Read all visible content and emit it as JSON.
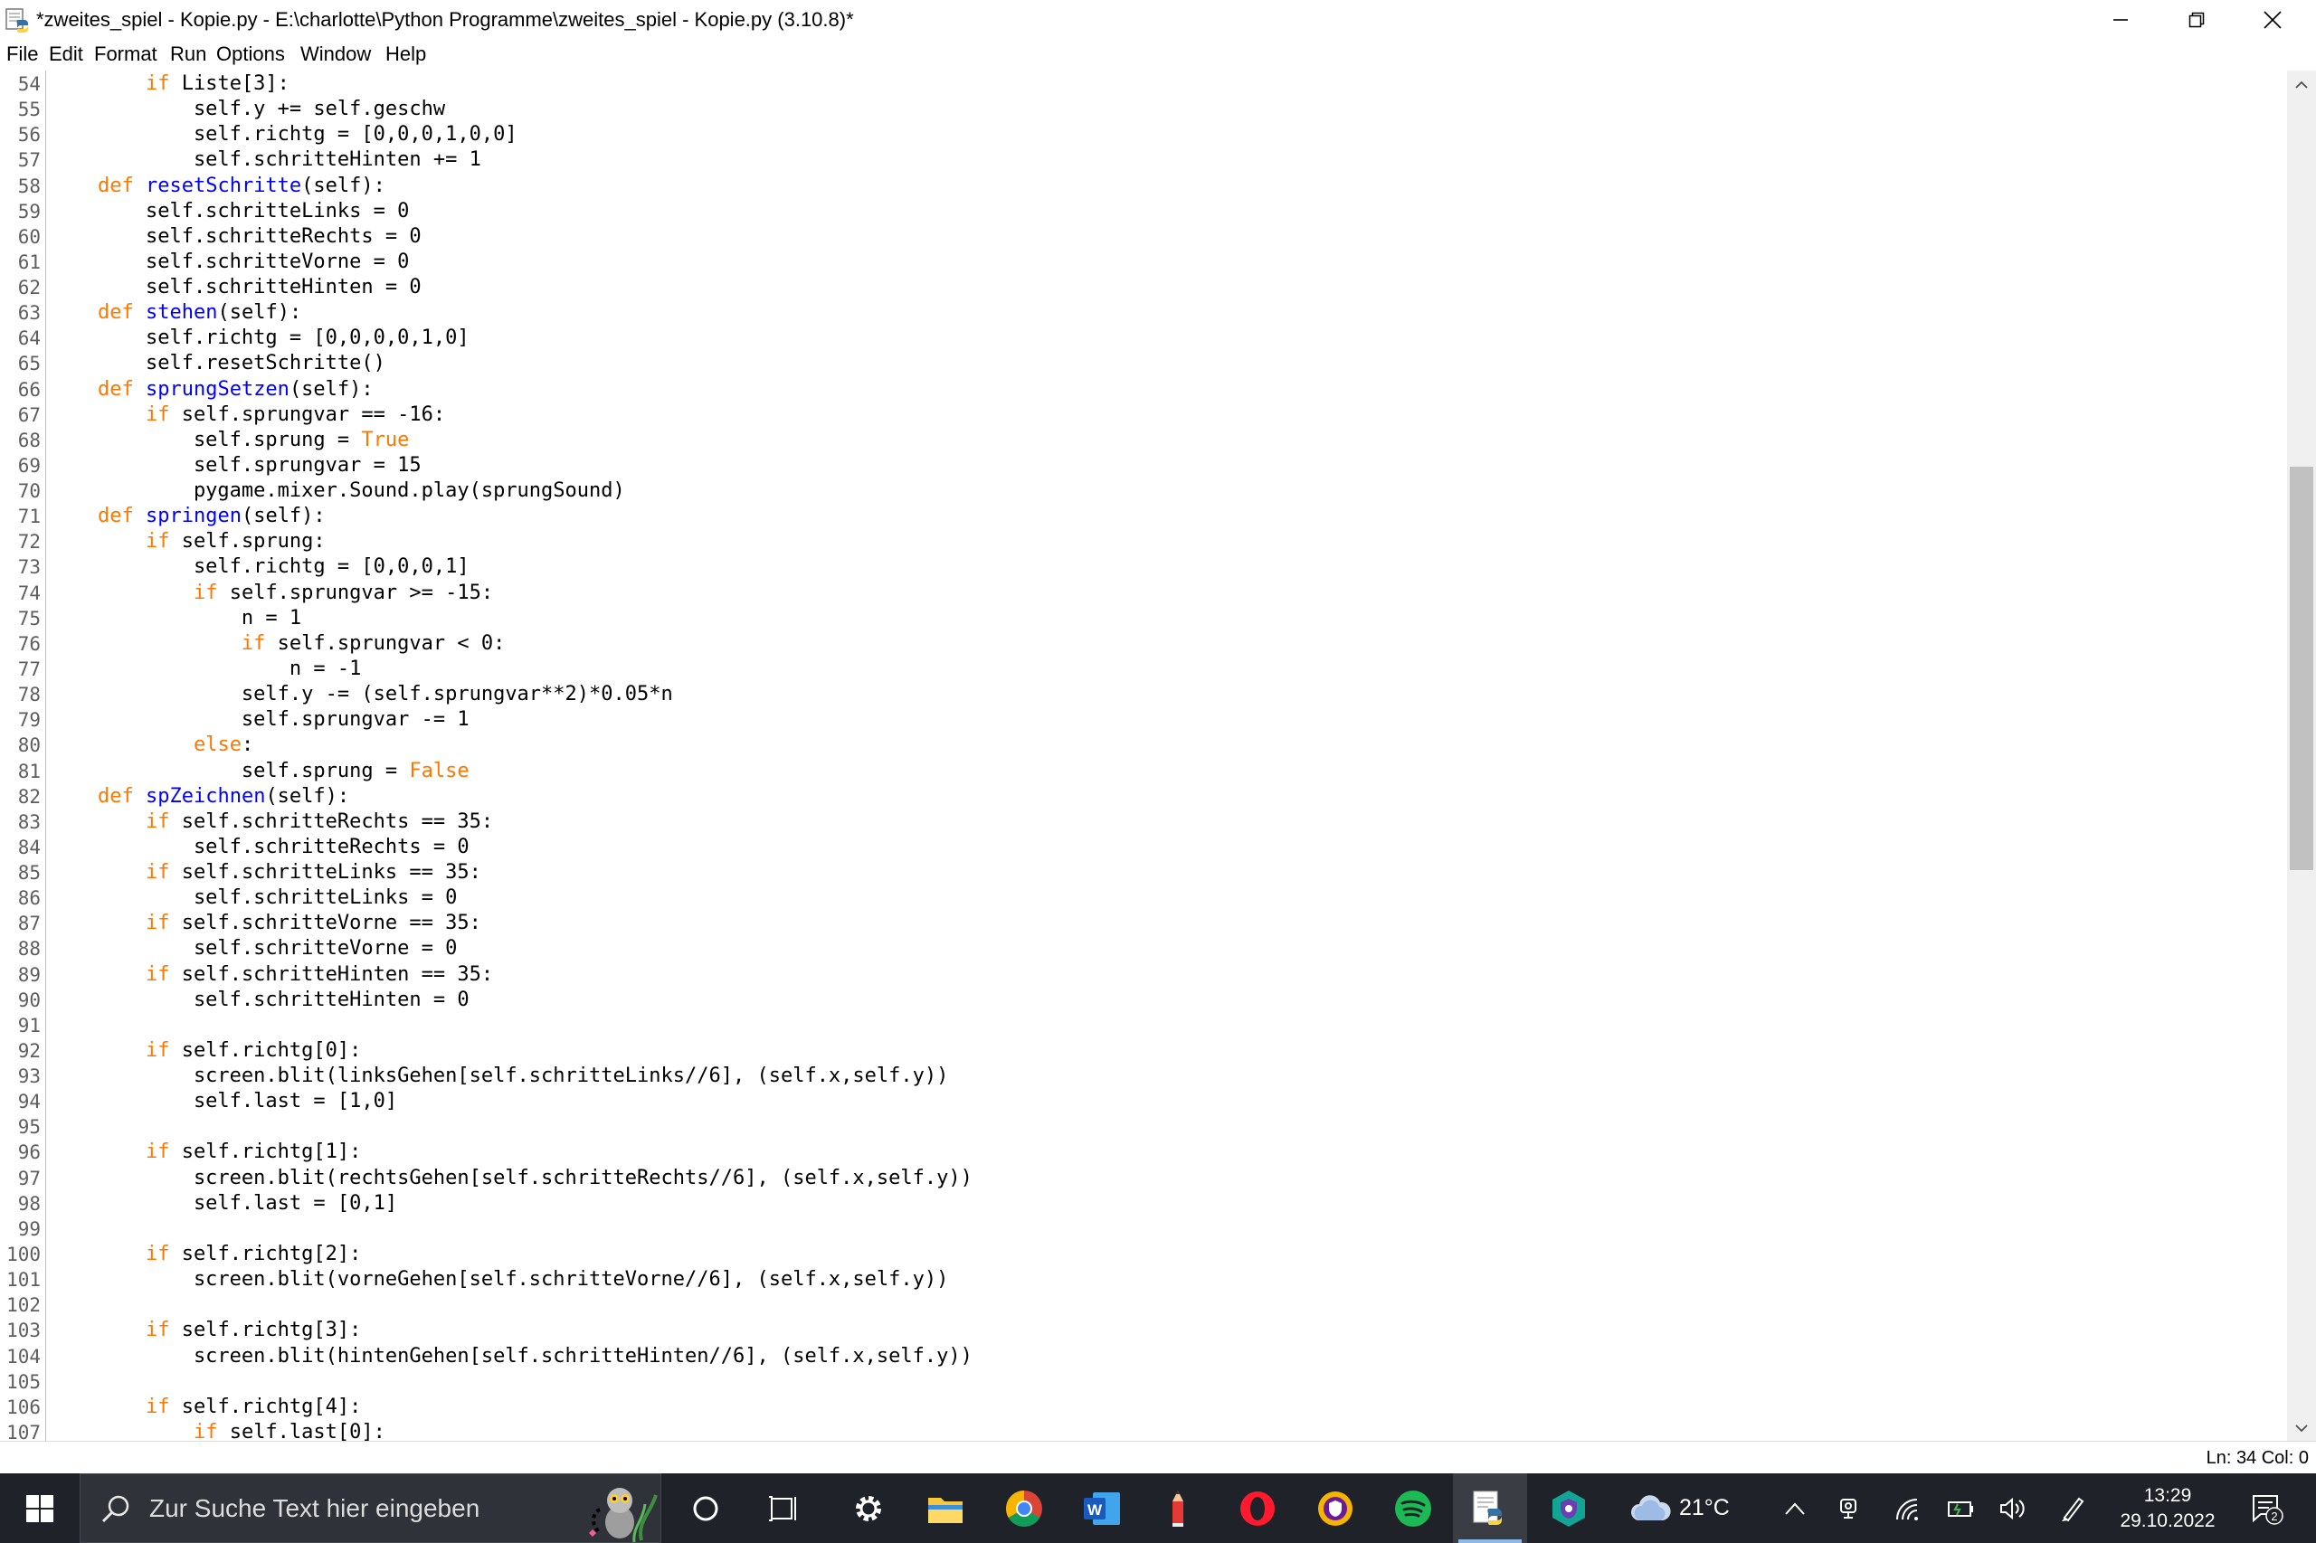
{
  "window": {
    "title": "*zweites_spiel - Kopie.py - E:\\charlotte\\Python Programme\\zweites_spiel - Kopie.py (3.10.8)*"
  },
  "menu": [
    "File",
    "Edit",
    "Format",
    "Run",
    "Options",
    "Window",
    "Help"
  ],
  "code_lines": [
    {
      "n": "54",
      "text": "        if Liste[3]:"
    },
    {
      "n": "55",
      "text": "            self.y += self.geschw"
    },
    {
      "n": "56",
      "text": "            self.richtg = [0,0,0,1,0,0]"
    },
    {
      "n": "57",
      "text": "            self.schritteHinten += 1"
    },
    {
      "n": "58",
      "text": "    def resetSchritte(self):"
    },
    {
      "n": "59",
      "text": "        self.schritteLinks = 0"
    },
    {
      "n": "60",
      "text": "        self.schritteRechts = 0"
    },
    {
      "n": "61",
      "text": "        self.schritteVorne = 0"
    },
    {
      "n": "62",
      "text": "        self.schritteHinten = 0"
    },
    {
      "n": "63",
      "text": "    def stehen(self):"
    },
    {
      "n": "64",
      "text": "        self.richtg = [0,0,0,0,1,0]"
    },
    {
      "n": "65",
      "text": "        self.resetSchritte()"
    },
    {
      "n": "66",
      "text": "    def sprungSetzen(self):"
    },
    {
      "n": "67",
      "text": "        if self.sprungvar == -16:"
    },
    {
      "n": "68",
      "text": "            self.sprung = True"
    },
    {
      "n": "69",
      "text": "            self.sprungvar = 15"
    },
    {
      "n": "70",
      "text": "            pygame.mixer.Sound.play(sprungSound)"
    },
    {
      "n": "71",
      "text": "    def springen(self):"
    },
    {
      "n": "72",
      "text": "        if self.sprung:"
    },
    {
      "n": "73",
      "text": "            self.richtg = [0,0,0,1]"
    },
    {
      "n": "74",
      "text": "            if self.sprungvar >= -15:"
    },
    {
      "n": "75",
      "text": "                n = 1"
    },
    {
      "n": "76",
      "text": "                if self.sprungvar < 0:"
    },
    {
      "n": "77",
      "text": "                    n = -1"
    },
    {
      "n": "78",
      "text": "                self.y -= (self.sprungvar**2)*0.05*n"
    },
    {
      "n": "79",
      "text": "                self.sprungvar -= 1"
    },
    {
      "n": "80",
      "text": "            else:"
    },
    {
      "n": "81",
      "text": "                self.sprung = False"
    },
    {
      "n": "82",
      "text": "    def spZeichnen(self):"
    },
    {
      "n": "83",
      "text": "        if self.schritteRechts == 35:"
    },
    {
      "n": "84",
      "text": "            self.schritteRechts = 0"
    },
    {
      "n": "85",
      "text": "        if self.schritteLinks == 35:"
    },
    {
      "n": "86",
      "text": "            self.schritteLinks = 0"
    },
    {
      "n": "87",
      "text": "        if self.schritteVorne == 35:"
    },
    {
      "n": "88",
      "text": "            self.schritteVorne = 0"
    },
    {
      "n": "89",
      "text": "        if self.schritteHinten == 35:"
    },
    {
      "n": "90",
      "text": "            self.schritteHinten = 0"
    },
    {
      "n": "91",
      "text": ""
    },
    {
      "n": "92",
      "text": "        if self.richtg[0]:"
    },
    {
      "n": "93",
      "text": "            screen.blit(linksGehen[self.schritteLinks//6], (self.x,self.y))"
    },
    {
      "n": "94",
      "text": "            self.last = [1,0]"
    },
    {
      "n": "95",
      "text": ""
    },
    {
      "n": "96",
      "text": "        if self.richtg[1]:"
    },
    {
      "n": "97",
      "text": "            screen.blit(rechtsGehen[self.schritteRechts//6], (self.x,self.y))"
    },
    {
      "n": "98",
      "text": "            self.last = [0,1]"
    },
    {
      "n": "99",
      "text": ""
    },
    {
      "n": "100",
      "text": "        if self.richtg[2]:"
    },
    {
      "n": "101",
      "text": "            screen.blit(vorneGehen[self.schritteVorne//6], (self.x,self.y))"
    },
    {
      "n": "102",
      "text": ""
    },
    {
      "n": "103",
      "text": "        if self.richtg[3]:"
    },
    {
      "n": "104",
      "text": "            screen.blit(hintenGehen[self.schritteHinten//6], (self.x,self.y))"
    },
    {
      "n": "105",
      "text": ""
    },
    {
      "n": "106",
      "text": "        if self.richtg[4]:"
    },
    {
      "n": "107",
      "text": "            if self.last[0]:"
    }
  ],
  "status": {
    "position": "Ln: 34  Col: 0"
  },
  "taskbar": {
    "search_placeholder": "Zur Suche Text hier eingeben",
    "weather": "21°C",
    "time": "13:29",
    "date": "29.10.2022",
    "notification_count": "2"
  },
  "colors": {
    "keyword": "#ff7700",
    "definition": "#0000ff",
    "taskbar": "#1f2228"
  }
}
